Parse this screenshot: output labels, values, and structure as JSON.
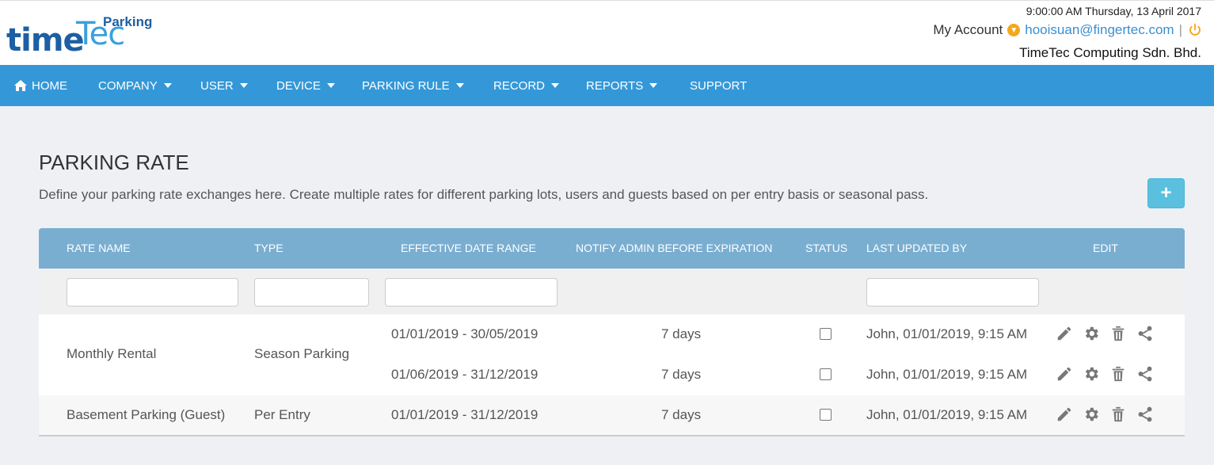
{
  "header": {
    "logo": {
      "time": "time",
      "tec": "Tec",
      "parking": "Parking"
    },
    "datetime": "9:00:00 AM Thursday, 13 April 2017",
    "my_account": "My Account",
    "email": "hooisuan@fingertec.com",
    "separator": "|",
    "company": "TimeTec Computing Sdn. Bhd.",
    "accent_color": "#f3a81b"
  },
  "nav": {
    "background": "#3498d8",
    "items": [
      {
        "label": "HOME",
        "icon": "home-icon",
        "dropdown": false
      },
      {
        "label": "COMPANY",
        "dropdown": true
      },
      {
        "label": "USER",
        "dropdown": true
      },
      {
        "label": "DEVICE",
        "dropdown": true
      },
      {
        "label": "PARKING RULE",
        "dropdown": true
      },
      {
        "label": "RECORD",
        "dropdown": true
      },
      {
        "label": "REPORTS",
        "dropdown": true
      },
      {
        "label": "SUPPORT",
        "dropdown": false
      }
    ]
  },
  "page": {
    "title": "PARKING RATE",
    "description": "Define your parking rate exchanges here. Create multiple rates for different parking lots, users and guests based on per entry basis or seasonal pass.",
    "add_button": "+"
  },
  "table": {
    "columns": [
      "RATE NAME",
      "TYPE",
      "EFFECTIVE DATE RANGE",
      "NOTIFY ADMIN BEFORE EXPIRATION",
      "STATUS",
      "LAST UPDATED BY",
      "EDIT"
    ],
    "filters": {
      "rate_name": "",
      "type": "",
      "date_range": "",
      "last_updated": ""
    },
    "rows": [
      {
        "rate_name": "Monthly Rental",
        "type": "Season Parking",
        "entries": [
          {
            "date_range": "01/01/2019 - 30/05/2019",
            "notify": "7 days",
            "status": false,
            "updated_by": "John, 01/01/2019, 9:15 AM"
          },
          {
            "date_range": "01/06/2019 - 31/12/2019",
            "notify": "7 days",
            "status": false,
            "updated_by": "John, 01/01/2019, 9:15 AM"
          }
        ]
      },
      {
        "rate_name": "Basement Parking (Guest)",
        "type": "Per Entry",
        "entries": [
          {
            "date_range": "01/01/2019 - 31/12/2019",
            "notify": "7 days",
            "status": false,
            "updated_by": "John, 01/01/2019, 9:15 AM"
          }
        ]
      }
    ],
    "action_icons": [
      "pencil-icon",
      "gear-icon",
      "trash-icon",
      "share-icon"
    ]
  }
}
